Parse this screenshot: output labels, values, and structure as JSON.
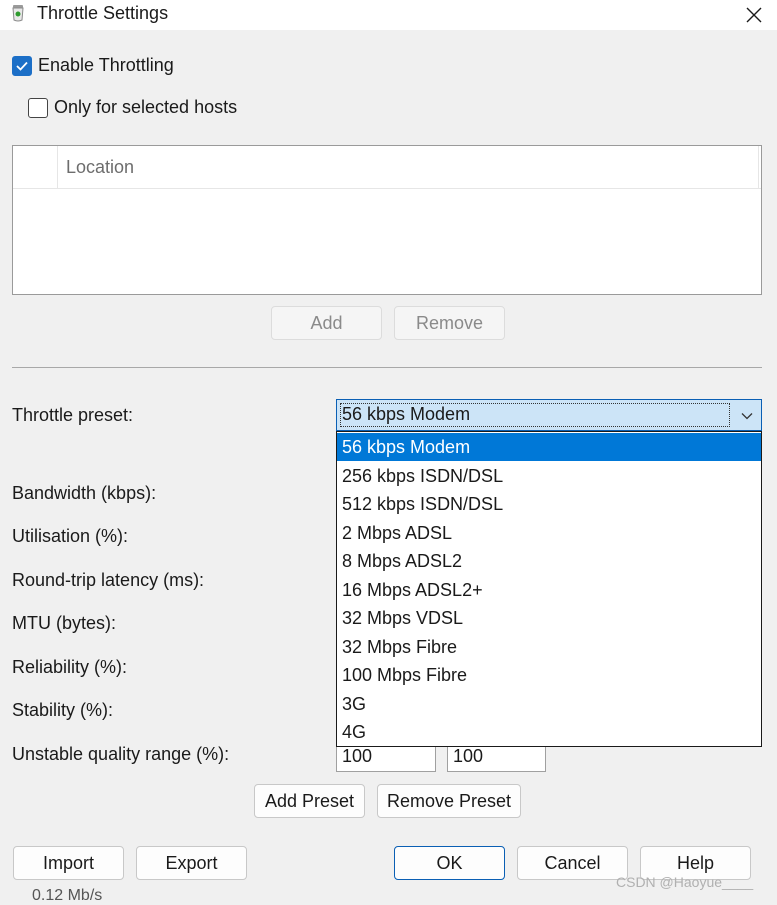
{
  "window": {
    "title": "Throttle Settings"
  },
  "enable_throttling": {
    "label": "Enable Throttling",
    "checked": true
  },
  "only_selected_hosts": {
    "label": "Only for selected hosts",
    "checked": false
  },
  "hosts_list": {
    "column_header": "Location"
  },
  "hosts_buttons": {
    "add": "Add",
    "remove": "Remove"
  },
  "fields": {
    "throttle_preset": "Throttle preset:",
    "bandwidth": "Bandwidth (kbps):",
    "utilisation": "Utilisation (%):",
    "latency": "Round-trip latency (ms):",
    "mtu": "MTU (bytes):",
    "reliability": "Reliability (%):",
    "stability": "Stability (%):",
    "unstable_range": "Unstable quality range (%):"
  },
  "unstable_range_values": {
    "min": "100",
    "max": "100"
  },
  "preset": {
    "selected": "56 kbps Modem",
    "options": [
      "56 kbps Modem",
      "256 kbps ISDN/DSL",
      "512 kbps ISDN/DSL",
      "2 Mbps ADSL",
      "8 Mbps ADSL2",
      "16 Mbps ADSL2+",
      "32 Mbps VDSL",
      "32 Mbps Fibre",
      "100 Mbps Fibre",
      "3G",
      "4G"
    ]
  },
  "preset_buttons": {
    "add": "Add Preset",
    "remove": "Remove Preset"
  },
  "footer_buttons": {
    "import": "Import",
    "export": "Export",
    "ok": "OK",
    "cancel": "Cancel",
    "help": "Help"
  },
  "watermark": "CSDN @Haoyue____",
  "behind_text": "0.12 Mb/s",
  "colors": {
    "accent": "#0078d7",
    "checkbox": "#1c6fc7",
    "combo_bg": "#cce4f7"
  }
}
